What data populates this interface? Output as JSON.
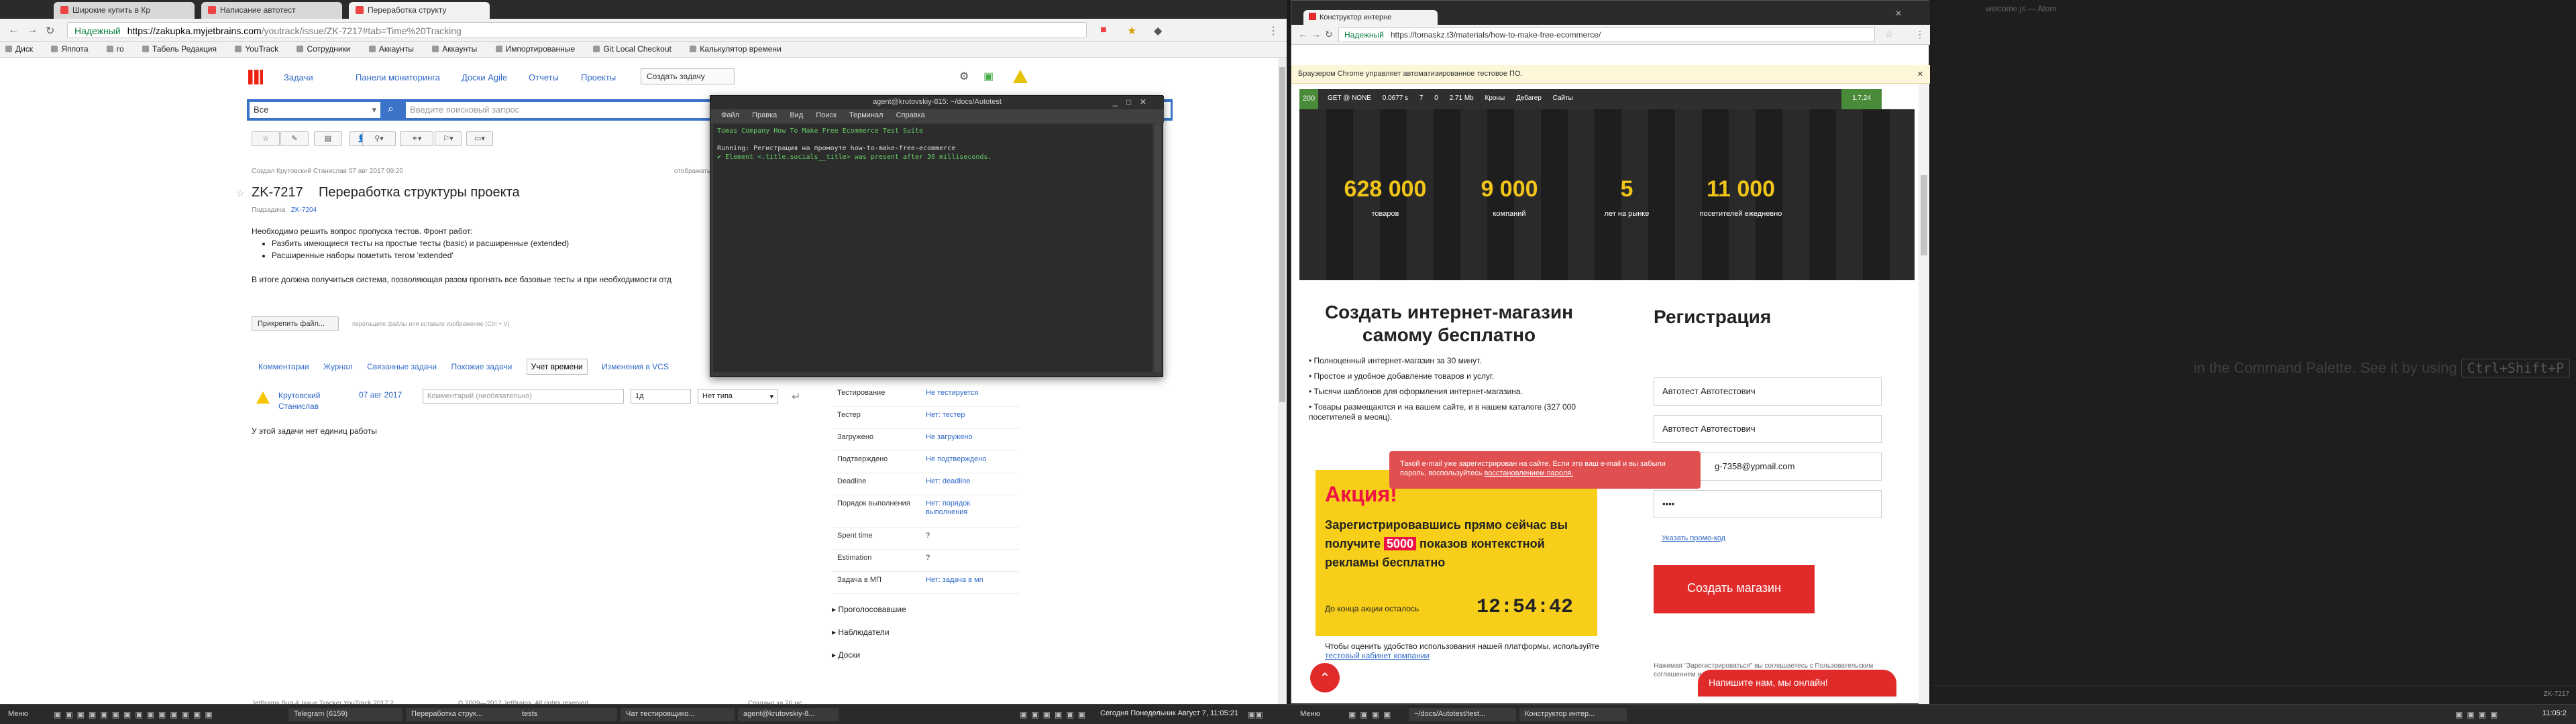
{
  "left_browser": {
    "tabs": [
      "Широкие купить в Кр",
      "Написание автотест",
      "Переработка структу"
    ],
    "url_secure": "Надежный",
    "url_host": "https://zakupka.myjetbrains.com",
    "url_path": "/youtrack/issue/ZK-7217#tab=Time%20Tracking",
    "bookmarks": [
      "Диск",
      "Яппота",
      "го",
      "Табель Редакция",
      "YouTrack",
      "Сотрудники",
      "Аккаунты",
      "Аккаунты",
      "Импортированные",
      "Git Local Checkout",
      "Калькулятор времени"
    ]
  },
  "youtrack": {
    "menu": [
      "Задачи",
      "Панели мониторинга",
      "Доски Agile",
      "Отчеты",
      "Проекты"
    ],
    "create_label": "Создать задачу",
    "search_select": "Все",
    "search_placeholder": "Введите поисковый запрос",
    "meta": "Создал Крутовский Станислав 07 авг 2017 09:20",
    "meta_right": "отображать",
    "issue_id": "ZK-7217",
    "issue_title": "Переработка структуры проекта",
    "sub": "Подзадача",
    "sub_link": "ZK-7204",
    "desc_1": "Необходимо решить вопрос пропуска тестов. Фронт работ:",
    "desc_li_1": "Разбить имеющиеся тесты на простые тесты (basic) и расширенные (extended)",
    "desc_li_2": "Расширенные наборы пометить тегом 'extended'",
    "desc_2": "В итоге должна получиться система, позволяющая разом прогнать все базовые тесты и при необходимости отд",
    "attach_label": "Прикрепить файл...",
    "attach_hint": "перетащите файлы или вставьте изображение (Ctrl + V)",
    "tabs": [
      "Комментарии",
      "Журнал",
      "Связанные задачи",
      "Похожие задачи",
      "Учет времени",
      "Изменения в VCS"
    ],
    "wi_user": "Крутовский Станислав",
    "wi_date": "07 авг 2017",
    "wi_comment_ph": "Комментарий (необязательно)",
    "wi_duration": "1д",
    "wi_type": "Нет типа",
    "no_units": "У этой задачи нет единиц работы",
    "fields": [
      {
        "label": "Тестирование",
        "value": "Не тестируется"
      },
      {
        "label": "Тестер",
        "value": "Нет: тестер"
      },
      {
        "label": "Загружено",
        "value": "Не загружено"
      },
      {
        "label": "Подтверждено",
        "value": "Не подтверждено"
      },
      {
        "label": "Deadline",
        "value": "Нет: deadline"
      },
      {
        "label": "Порядок выполнения",
        "value": "Нет: порядок выполнения"
      },
      {
        "label": "Spent time",
        "value": "?"
      },
      {
        "label": "Estimation",
        "value": "?"
      },
      {
        "label": "Задача в МП",
        "value": "Нет: задача в мп"
      }
    ],
    "sections": [
      "Проголосовавшие",
      "Наблюдатели",
      "Доски"
    ],
    "footer_left": "JetBrains Bug & Issue Tracker YouTrack 2017.2",
    "footer_mid": "© 2009—2017 JetBrains. All rights reserved.",
    "footer_right": "Создано за 26 мс"
  },
  "terminal": {
    "title": "agent@krutovskiy-815: ~/docs/Autotest",
    "menu": [
      "Файл",
      "Правка",
      "Вид",
      "Поиск",
      "Терминал",
      "Справка"
    ],
    "line_1": "Tomas Company How To Make Free Ecommerce Test Suite",
    "line_2": "Running:  Регистрация на промоуте how-to-make-free-ecommerce",
    "line_3": " ✔ Element <.title.socials__title> was present after 36 milliseconds."
  },
  "right_browser": {
    "tab": "Конструктор интерне",
    "url_secure": "Надежный",
    "url": "https://tomaskz.t3/materials/how-to-make-free-ecommerce/",
    "info": "Браузером Chrome управляет автоматизированное тестовое ПО.",
    "debug": [
      "200",
      "GET @ NONE",
      "0.0677 s",
      "7",
      "0",
      "2.71 Mb",
      "Кроны",
      "Дебагер",
      "Сайты"
    ],
    "debug_ver": "1.7.24",
    "stats": [
      {
        "num": "628 000",
        "label": "товаров"
      },
      {
        "num": "9 000",
        "label": "компаний"
      },
      {
        "num": "5",
        "label": "лет на рынке"
      },
      {
        "num": "11 000",
        "label": "посетителей ежедневно"
      }
    ],
    "h1": "Создать интернет-магазин самому бесплатно",
    "bullets": [
      "Полноценный интернет-магазин за 30 минут.",
      "Простое и удобное добавление товаров и услуг.",
      "Тысячи шаблонов для оформления интернет-магазина.",
      "Товары размещаются и на вашем сайте, и в нашем каталоге (327 000 посетителей в месяц)."
    ],
    "promo_title": "Акция!",
    "promo_a": "Зарегистрировавшись прямо сейчас вы получите",
    "promo_num": "5000",
    "promo_b": "показов контекстной рекламы бесплатно",
    "timer_label": "До конца акции осталось",
    "timer": "12:54:42",
    "disc_a": "Чтобы оценить удобство использования нашей платформы, используйте",
    "disc_link": "тестовый кабинет компании",
    "reg_title": "Регистрация",
    "reg_values": [
      "Автотест Автотестович",
      "Автотест Автотестович",
      "g-7358@ypmail.com",
      "••••"
    ],
    "reg_link": "Указать промо-код",
    "reg_btn": "Создать магазин",
    "reg_tiny": "Нажимая \"Зарегистрироваться\" вы соглашаетесь с Пользовательским соглашением и Политикой",
    "tooltip_a": "Такой e-mail уже зарегистрирован на сайте. Если это ваш e-mail и вы забыли пароль, воспользуйтесь",
    "tooltip_link": "восстановлением пароля.",
    "chat": "Напишите нам, мы онлайн!"
  },
  "editor": {
    "title": "welcome.js — Atom",
    "hint": "in the Command Palette. See it by using",
    "kbd": "Ctrl+Shift+P",
    "foot": "ZK-7217"
  },
  "taskbar": {
    "menu": "Меню",
    "items": [
      "Telegram (6159)",
      "Переработка струк...",
      "tests",
      "Чат тестировщико...",
      "agent@krutovskiy-8...",
      "Меню",
      "~/docs/Autotest/test...",
      "Конструктор интер..."
    ],
    "clock": "Сегодня Понедельник Август 7, 11:05:21",
    "clock_right": "11:05:2"
  }
}
